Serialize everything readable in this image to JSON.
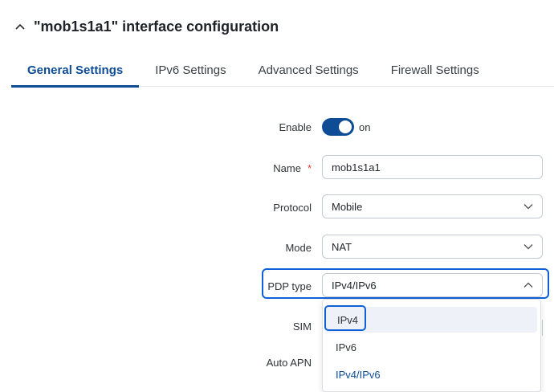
{
  "header": {
    "title": "\"mob1s1a1\" interface configuration",
    "collapse_icon": "chevron-up-icon"
  },
  "tabs": [
    {
      "label": "General Settings",
      "active": true
    },
    {
      "label": "IPv6 Settings",
      "active": false
    },
    {
      "label": "Advanced Settings",
      "active": false
    },
    {
      "label": "Firewall Settings",
      "active": false
    }
  ],
  "form": {
    "enable": {
      "label": "Enable",
      "value": "on",
      "checked": true
    },
    "name": {
      "label": "Name",
      "required_mark": "*",
      "value": "mob1s1a1"
    },
    "protocol": {
      "label": "Protocol",
      "value": "Mobile"
    },
    "mode": {
      "label": "Mode",
      "value": "NAT"
    },
    "pdp_type": {
      "label": "PDP type",
      "value": "IPv4/IPv6",
      "expanded": true
    },
    "sim": {
      "label": "SIM"
    },
    "auto_apn": {
      "label": "Auto APN"
    }
  },
  "pdp_options": [
    "IPv4",
    "IPv6",
    "IPv4/IPv6"
  ],
  "colors": {
    "accent": "#0e4d96",
    "highlight": "#1060d8",
    "required": "#e5372f"
  }
}
